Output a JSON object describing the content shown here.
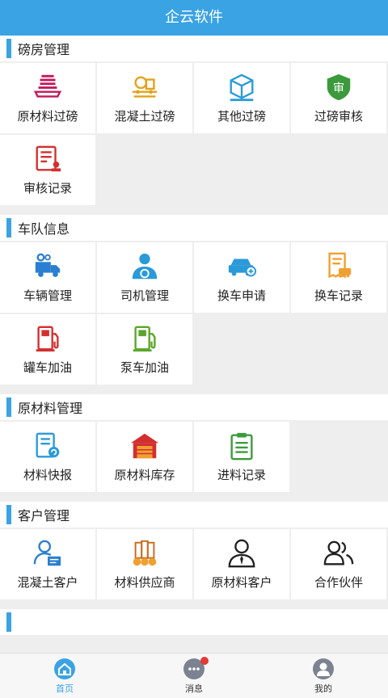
{
  "header": {
    "title": "企云软件"
  },
  "sections": [
    {
      "title": "磅房管理",
      "items": [
        "原材料过磅",
        "混凝土过磅",
        "其他过磅",
        "过磅审核",
        "审核记录"
      ]
    },
    {
      "title": "车队信息",
      "items": [
        "车辆管理",
        "司机管理",
        "换车申请",
        "换车记录",
        "罐车加油",
        "泵车加油"
      ]
    },
    {
      "title": "原材料管理",
      "items": [
        "材料快报",
        "原材料库存",
        "进料记录"
      ]
    },
    {
      "title": "客户管理",
      "items": [
        "混凝土客户",
        "材料供应商",
        "原材料客户",
        "合作伙伴"
      ]
    }
  ],
  "tabbar": {
    "home": "首页",
    "messages": "消息",
    "mine": "我的"
  },
  "colors": {
    "accent": "#3aa3e3",
    "badge": "#e53935"
  }
}
